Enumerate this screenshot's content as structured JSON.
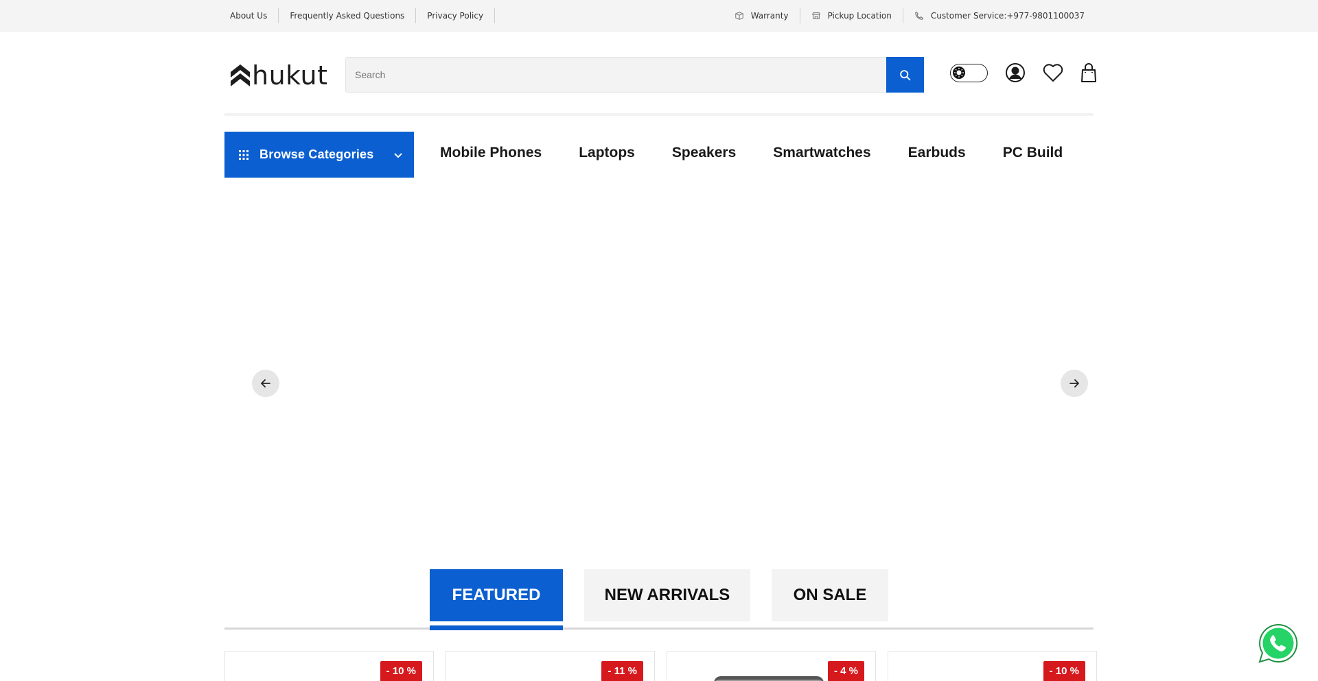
{
  "topbar": {
    "links": [
      "About Us",
      "Frequently Asked Questions",
      "Privacy Policy"
    ],
    "info": {
      "warranty": "Warranty",
      "pickup": "Pickup Location",
      "service": "Customer Service:+977-9801100037"
    }
  },
  "header": {
    "logo_text": "hukut",
    "search_placeholder": "Search",
    "search_icon": "search-icon",
    "icons": [
      "theme-toggle",
      "user-icon",
      "heart-icon",
      "bag-icon"
    ]
  },
  "nav": {
    "browse_label": "Browse Categories",
    "items": [
      "Mobile Phones",
      "Laptops",
      "Speakers",
      "Smartwatches",
      "Earbuds",
      "PC Build"
    ]
  },
  "tabs": [
    "FEATURED",
    "NEW ARRIVALS",
    "ON SALE"
  ],
  "products": [
    {
      "discount": "- 10 %"
    },
    {
      "discount": "- 11 %"
    },
    {
      "discount": "- 4 %"
    },
    {
      "discount": "- 10 %"
    }
  ],
  "colors": {
    "primary": "#0b5fd1",
    "badge": "#d6191d",
    "whatsapp": "#25d366"
  }
}
